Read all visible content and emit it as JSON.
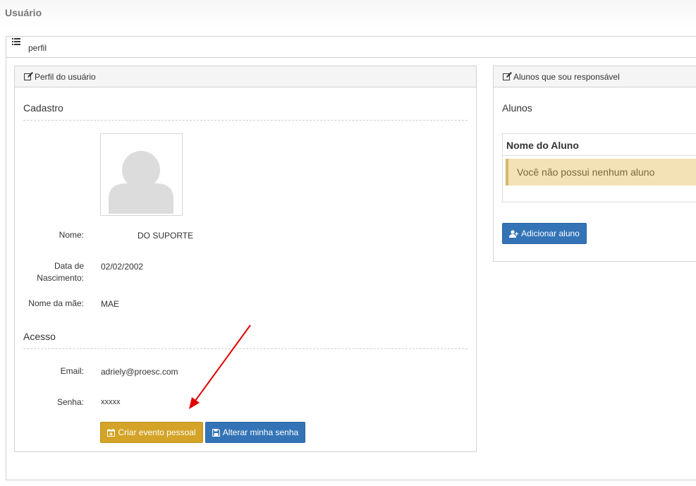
{
  "page": {
    "title": "Usuário"
  },
  "outer": {
    "tab_label": "perfil"
  },
  "profile_panel": {
    "title": "Perfil do usuário",
    "cadastro_title": "Cadastro",
    "fields": {
      "nome_label": "Nome:",
      "nome_value": "DO SUPORTE",
      "nascimento_label_line1": "Data de",
      "nascimento_label_line2": "Nascimento:",
      "nascimento_value": "02/02/2002",
      "mae_label": "Nome da mãe:",
      "mae_value": "MAE"
    },
    "acesso_title": "Acesso",
    "acesso": {
      "email_label": "Email:",
      "email_value": "adriely@proesc.com",
      "senha_label": "Senha:",
      "senha_value": "xxxxx"
    },
    "buttons": {
      "criar_evento": "Criar evento pessoal",
      "alterar_senha": "Alterar minha senha"
    }
  },
  "students_panel": {
    "title": "Alunos que sou responsável",
    "section_title": "Alunos",
    "table_header": "Nome do Aluno",
    "empty_message": "Você não possui nenhum aluno",
    "add_button": "Adicionar aluno"
  },
  "colors": {
    "warning": "#d4a327",
    "primary": "#3474b6",
    "alert_bg": "#f2e2b5",
    "annotation_arrow": "#e00000"
  }
}
